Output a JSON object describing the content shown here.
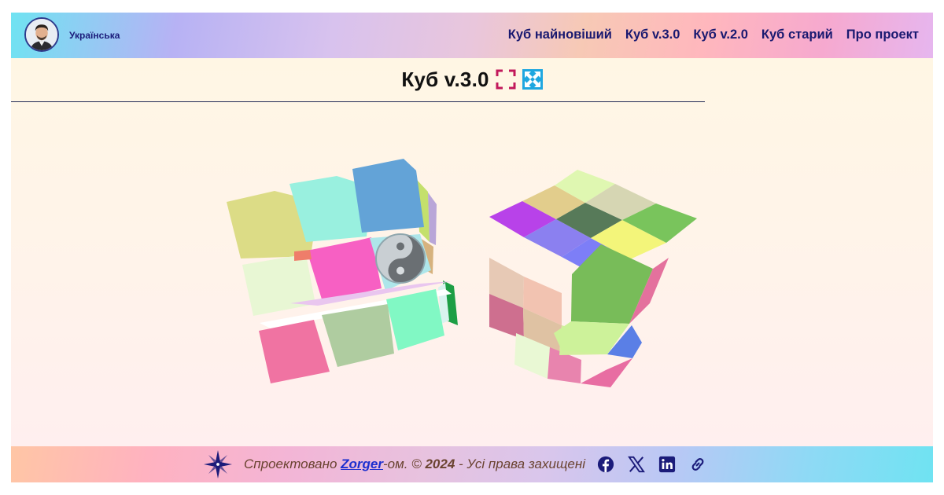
{
  "header": {
    "language": "Українська",
    "nav": [
      {
        "label": "Куб найновіший"
      },
      {
        "label": "Куб v.3.0"
      },
      {
        "label": "Куб v.2.0"
      },
      {
        "label": "Куб старий"
      },
      {
        "label": "Про проект"
      }
    ]
  },
  "page": {
    "title": "Куб v.3.0"
  },
  "footer": {
    "prefix": "Спроектовано ",
    "author": "Zorger",
    "suffix": "-ом. © ",
    "year": "2024",
    "rights": " - Усі права захищені"
  },
  "icons": {
    "fullscreen": "fullscreen-icon",
    "expand": "expand-arrows-icon",
    "facebook": "facebook-icon",
    "x": "x-icon",
    "linkedin": "linkedin-icon",
    "link": "link-icon",
    "compass": "compass-logo"
  },
  "colors": {
    "nav_text": "#191970",
    "accent_fullscreen": "#c2185b",
    "accent_expand": "#1fa7e0",
    "footer_link": "#1d2fcf",
    "social": "#1b1b7a"
  }
}
